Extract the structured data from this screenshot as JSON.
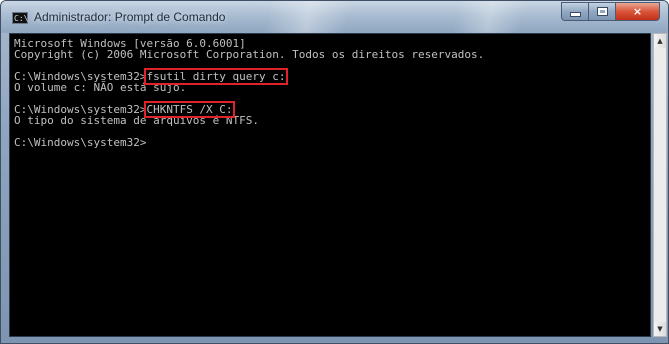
{
  "window": {
    "title": "Administrador: Prompt de Comando",
    "icon_text": "C:\\",
    "controls": {
      "minimize": "minimize-icon",
      "maximize": "maximize-icon",
      "close": "×"
    }
  },
  "console": {
    "lines": [
      {
        "text": "Microsoft Windows [versão 6.0.6001]"
      },
      {
        "text": "Copyright (c) 2006 Microsoft Corporation. Todos os direitos reservados."
      },
      {
        "text": ""
      },
      {
        "prefix": "C:\\Windows\\system32>",
        "command": "fsutil dirty query c:"
      },
      {
        "text": "O volume c: NÃO está sujo."
      },
      {
        "text": ""
      },
      {
        "prefix": "C:\\Windows\\system32>",
        "command": "CHKNTFS /X C:"
      },
      {
        "text": "O tipo do sistema de arquivos é NTFS."
      },
      {
        "text": ""
      },
      {
        "text": "C:\\Windows\\system32>"
      }
    ]
  },
  "scrollbar": {
    "up": "▲",
    "down": "▼"
  },
  "colors": {
    "console_bg": "#000000",
    "console_fg": "#c0c0c0",
    "highlight": "#e0232b",
    "close_button": "#c4301a"
  }
}
